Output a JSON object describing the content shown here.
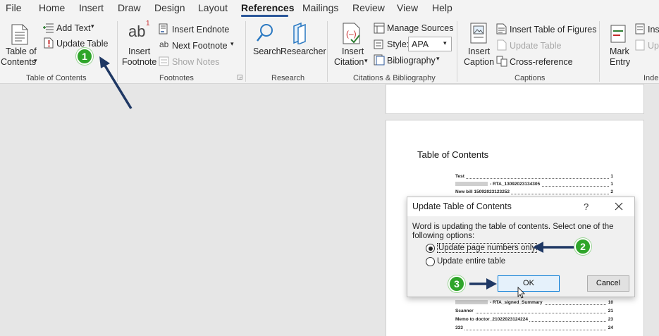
{
  "menu": {
    "tabs": [
      {
        "label": "File"
      },
      {
        "label": "Home"
      },
      {
        "label": "Insert"
      },
      {
        "label": "Draw"
      },
      {
        "label": "Design"
      },
      {
        "label": "Layout"
      },
      {
        "label": "References",
        "active": true
      },
      {
        "label": "Mailings"
      },
      {
        "label": "Review"
      },
      {
        "label": "View"
      },
      {
        "label": "Help"
      }
    ]
  },
  "ribbon": {
    "toc_group": {
      "label": "Table of Contents",
      "toc_button_line1": "Table of",
      "toc_button_line2": "Contents",
      "add_text": "Add Text",
      "update_table": "Update Table"
    },
    "footnotes_group": {
      "label": "Footnotes",
      "insert_footnote_line1": "Insert",
      "insert_footnote_line2": "Footnote",
      "insert_endnote": "Insert Endnote",
      "next_footnote": "Next Footnote",
      "show_notes": "Show Notes",
      "icon_text": "ab",
      "icon_superscript": "1",
      "small_icon_text": "ab"
    },
    "research_group": {
      "label": "Research",
      "search": "Search",
      "researcher": "Researcher"
    },
    "citations_group": {
      "label": "Citations & Bibliography",
      "insert_citation_line1": "Insert",
      "insert_citation_line2": "Citation",
      "manage_sources": "Manage Sources",
      "style_label": "Style:",
      "style_value": "APA",
      "bibliography": "Bibliography"
    },
    "captions_group": {
      "label": "Captions",
      "insert_caption_line1": "Insert",
      "insert_caption_line2": "Caption",
      "insert_table_of_figures": "Insert Table of Figures",
      "update_table": "Update Table",
      "cross_reference": "Cross-reference"
    },
    "index_group": {
      "label_partial": "Inde",
      "mark_entry_line1": "Mark",
      "mark_entry_line2": "Entry",
      "insert_partial": "Ins",
      "update_partial": "Up"
    }
  },
  "document": {
    "toc_heading": "Table of Contents",
    "toc_entries_top": [
      {
        "title": "Test",
        "page": "1",
        "blurred": false
      },
      {
        "title": "- RTA_13092023134305",
        "page": "1",
        "blurred": true
      },
      {
        "title": "New bill 15092023123252",
        "page": "2",
        "blurred": false
      }
    ],
    "toc_entries_bottom": [
      {
        "title": "- RTA_signed_Summary",
        "page": "10",
        "blurred": true
      },
      {
        "title": "Scanner",
        "page": "21",
        "blurred": false
      },
      {
        "title": "Memo to doctor_21022023124224",
        "page": "23",
        "blurred": false
      },
      {
        "title": "333",
        "page": "24",
        "blurred": false
      }
    ]
  },
  "dialog": {
    "title": "Update Table of Contents",
    "help": "?",
    "message": "Word is updating the table of contents.  Select one of the following options:",
    "option_page_numbers": "Update page numbers only",
    "option_entire_table": "Update entire table",
    "ok": "OK",
    "cancel": "Cancel"
  },
  "annotations": {
    "step1": "1",
    "step2": "2",
    "step3": "3",
    "badge_color": "#2fa52a",
    "arrow_color": "#1f3864"
  }
}
